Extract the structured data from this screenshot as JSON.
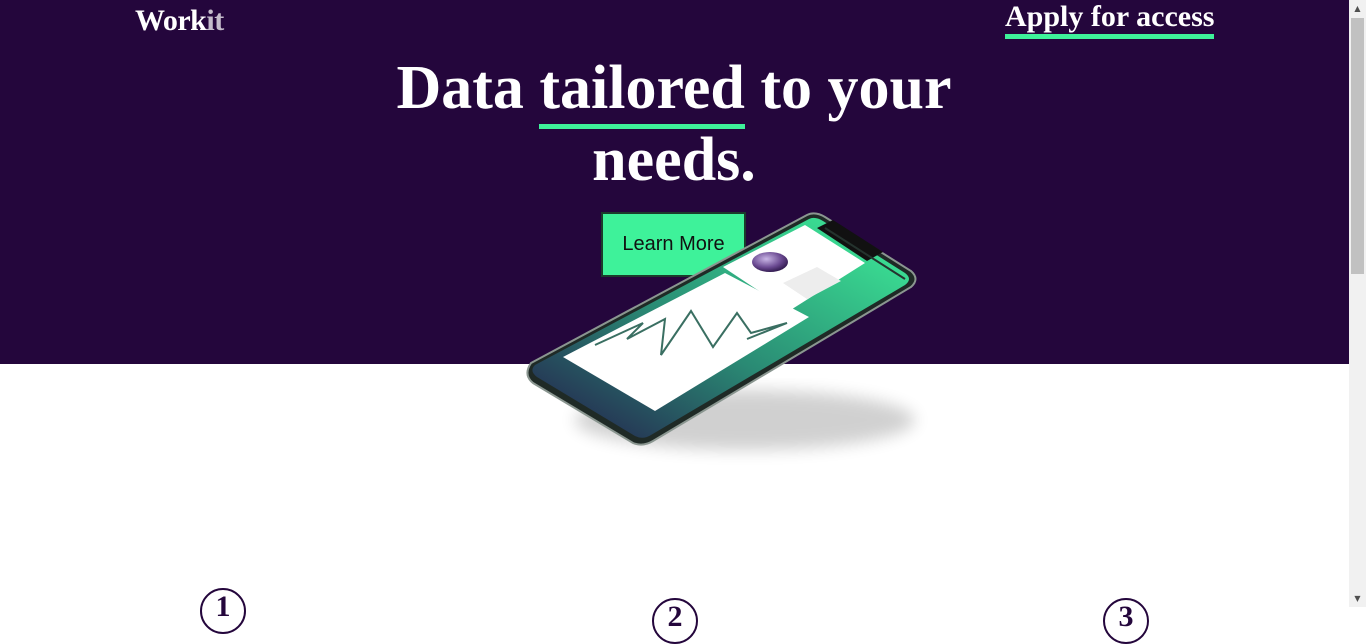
{
  "header": {
    "logo_main": "Work",
    "logo_accent": "it",
    "apply_link": "Apply for access"
  },
  "hero": {
    "headline_part1": "Data ",
    "headline_highlight": "tailored",
    "headline_part2": " to your needs.",
    "cta_label": "Learn More"
  },
  "steps": [
    {
      "number": "1"
    },
    {
      "number": "2"
    },
    {
      "number": "3"
    }
  ],
  "colors": {
    "hero_background": "#24063c",
    "accent": "#3ef29a",
    "text_light": "#ffffff"
  },
  "icons": {
    "scroll_up": "triangle-up-icon",
    "scroll_down": "triangle-down-icon"
  }
}
